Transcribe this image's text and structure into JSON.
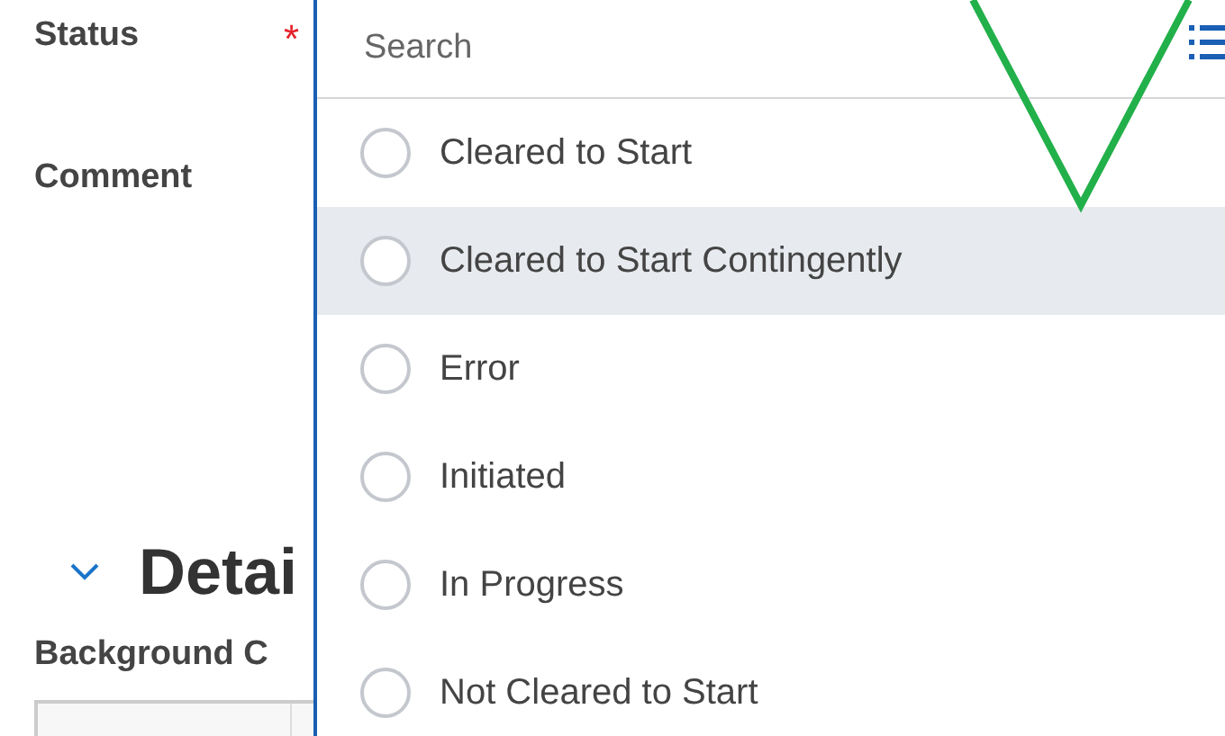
{
  "form": {
    "status_label": "Status",
    "required_mark": "*",
    "comment_label": "Comment",
    "section_title": "Detai",
    "section_expanded": true,
    "background_label": "Background C"
  },
  "dropdown": {
    "search": {
      "placeholder": "Search"
    },
    "options": [
      {
        "label": "Cleared to Start",
        "selected": false,
        "highlighted": false
      },
      {
        "label": "Cleared to Start Contingently",
        "selected": false,
        "highlighted": true
      },
      {
        "label": "Error",
        "selected": false,
        "highlighted": false
      },
      {
        "label": "Initiated",
        "selected": false,
        "highlighted": false
      },
      {
        "label": "In Progress",
        "selected": false,
        "highlighted": false
      },
      {
        "label": "Not Cleared to Start",
        "selected": false,
        "highlighted": false
      }
    ]
  }
}
